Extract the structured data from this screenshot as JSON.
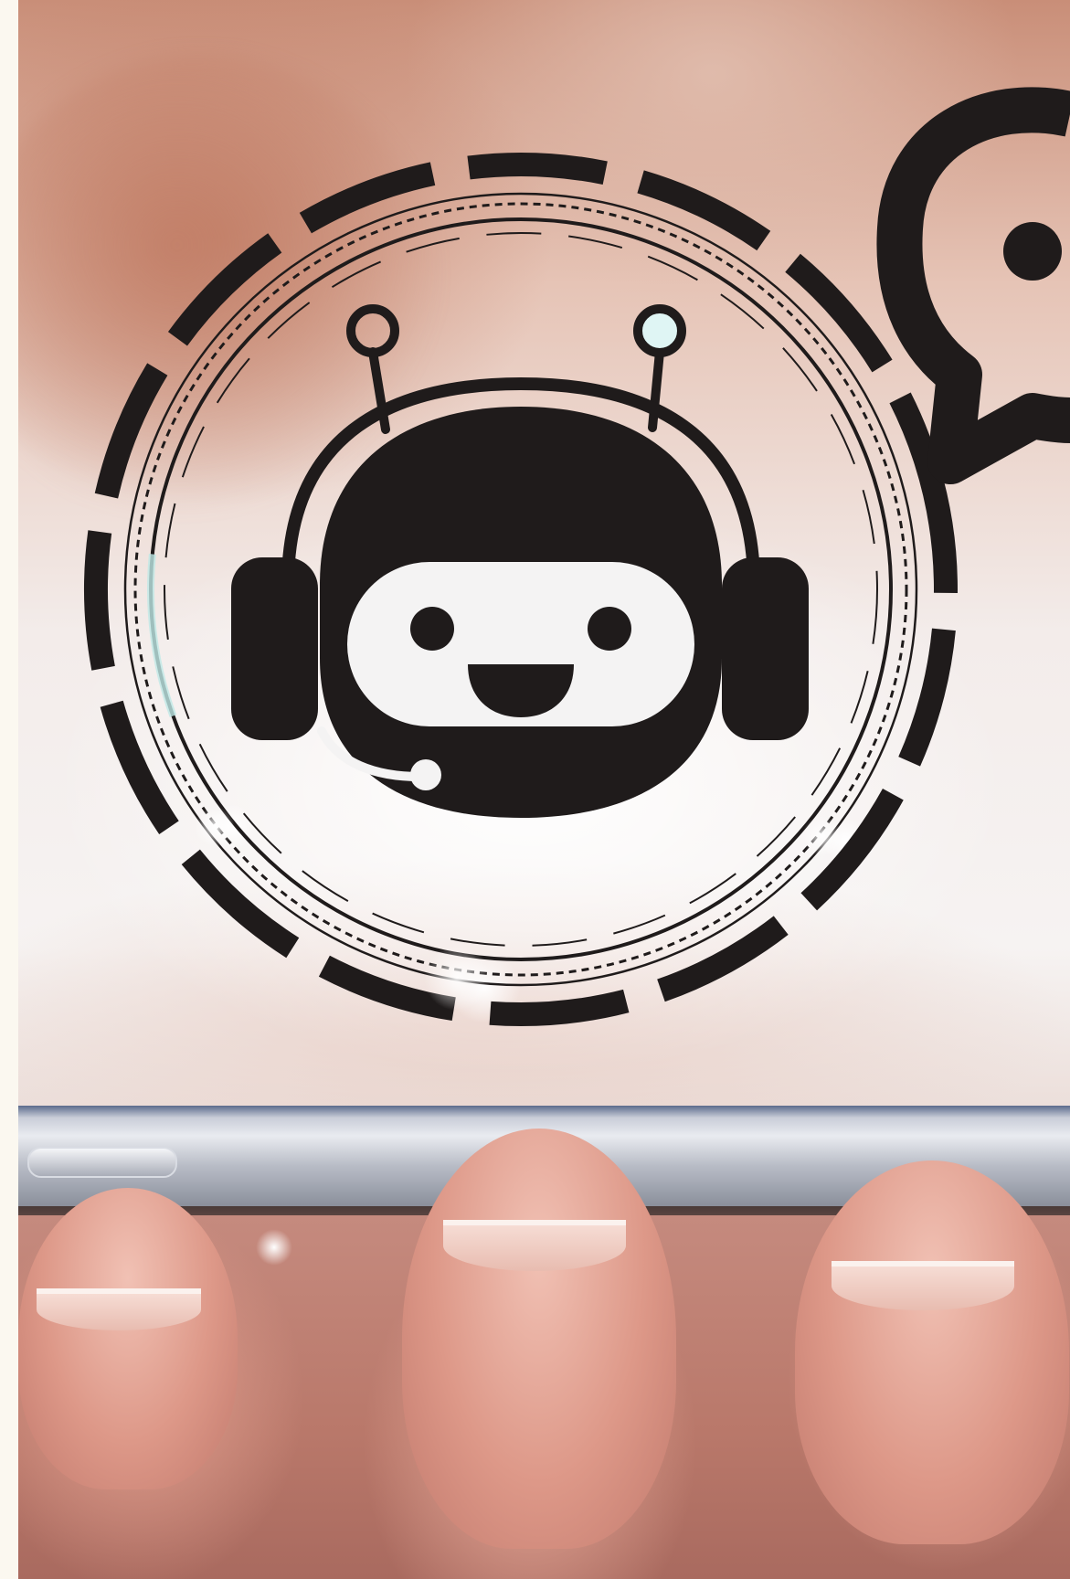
{
  "scene": {
    "description_tag": "photo",
    "palette": {
      "icon": "#1f1b1b",
      "skin": "#e2a090",
      "glow": "#ffffff",
      "phone": "#c9cdd8"
    },
    "icons": [
      "chatbot-icon",
      "speech-bubble-icon",
      "dashed-ring-icon"
    ]
  }
}
